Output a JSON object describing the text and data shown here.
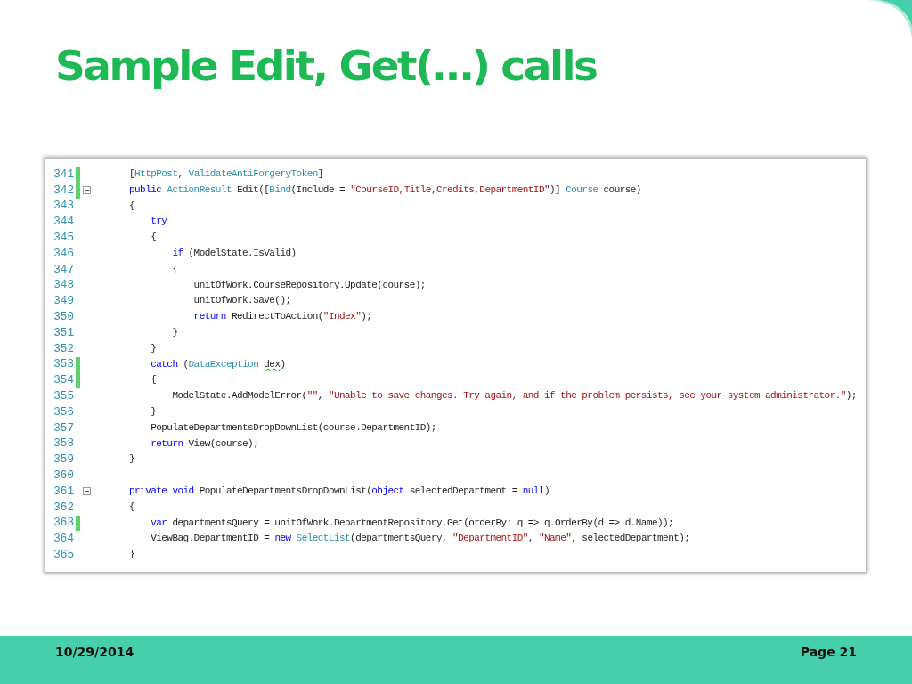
{
  "title": "Sample Edit, Get(…) calls",
  "code_lines": [
    {
      "number": "341",
      "changed": true,
      "foldable": false,
      "tokens": [
        {
          "kind": "plain",
          "text": "["
        },
        {
          "kind": "type",
          "text": "HttpPost"
        },
        {
          "kind": "plain",
          "text": ", "
        },
        {
          "kind": "type",
          "text": "ValidateAntiForgeryToken"
        },
        {
          "kind": "plain",
          "text": "]"
        }
      ]
    },
    {
      "number": "342",
      "changed": true,
      "foldable": true,
      "tokens": [
        {
          "kind": "keyword",
          "text": "public "
        },
        {
          "kind": "type",
          "text": "ActionResult"
        },
        {
          "kind": "plain",
          "text": " Edit(["
        },
        {
          "kind": "type",
          "text": "Bind"
        },
        {
          "kind": "plain",
          "text": "(Include = "
        },
        {
          "kind": "string",
          "text": "\"CourseID,Title,Credits,DepartmentID\""
        },
        {
          "kind": "plain",
          "text": ")] "
        },
        {
          "kind": "type",
          "text": "Course"
        },
        {
          "kind": "plain",
          "text": " course)"
        }
      ]
    },
    {
      "number": "343",
      "changed": false,
      "foldable": false,
      "tokens": [
        {
          "kind": "plain",
          "text": "{"
        }
      ],
      "children": [
        {
          "number": "344",
          "changed": false,
          "foldable": false,
          "tokens": [
            {
              "kind": "keyword",
              "text": "try"
            }
          ]
        },
        {
          "number": "345",
          "changed": false,
          "foldable": false,
          "tokens": [
            {
              "kind": "plain",
              "text": "{"
            }
          ],
          "children": [
            {
              "number": "346",
              "changed": false,
              "foldable": false,
              "tokens": [
                {
                  "kind": "keyword",
                  "text": "if"
                },
                {
                  "kind": "plain",
                  "text": " (ModelState.IsValid)"
                }
              ]
            },
            {
              "number": "347",
              "changed": false,
              "foldable": false,
              "tokens": [
                {
                  "kind": "plain",
                  "text": "{"
                }
              ],
              "children": [
                {
                  "number": "348",
                  "changed": false,
                  "foldable": false,
                  "tokens": [
                    {
                      "kind": "plain",
                      "text": "unitOfWork.CourseRepository.Update(course);"
                    }
                  ]
                },
                {
                  "number": "349",
                  "changed": false,
                  "foldable": false,
                  "tokens": [
                    {
                      "kind": "plain",
                      "text": "unitOfWork.Save();"
                    }
                  ]
                },
                {
                  "number": "350",
                  "changed": false,
                  "foldable": false,
                  "tokens": [
                    {
                      "kind": "keyword",
                      "text": "return"
                    },
                    {
                      "kind": "plain",
                      "text": " RedirectToAction("
                    },
                    {
                      "kind": "string",
                      "text": "\"Index\""
                    },
                    {
                      "kind": "plain",
                      "text": ");"
                    }
                  ]
                }
              ]
            },
            {
              "number": "351",
              "changed": false,
              "foldable": false,
              "tokens": [
                {
                  "kind": "plain",
                  "text": "}"
                }
              ]
            }
          ]
        },
        {
          "number": "352",
          "changed": false,
          "foldable": false,
          "tokens": [
            {
              "kind": "plain",
              "text": "}"
            }
          ]
        },
        {
          "number": "353",
          "changed": true,
          "foldable": false,
          "tokens": [
            {
              "kind": "keyword",
              "text": "catch"
            },
            {
              "kind": "plain",
              "text": " ("
            },
            {
              "kind": "type",
              "text": "DataException "
            },
            {
              "kind": "warning",
              "text": "dex"
            },
            {
              "kind": "plain",
              "text": ")"
            }
          ]
        },
        {
          "number": "354",
          "changed": true,
          "foldable": false,
          "tokens": [
            {
              "kind": "plain",
              "text": "{"
            }
          ],
          "children": [
            {
              "number": "355",
              "changed": false,
              "foldable": false,
              "tokens": [
                {
                  "kind": "plain",
                  "text": "ModelState.AddModelError("
                },
                {
                  "kind": "string",
                  "text": "\"\""
                },
                {
                  "kind": "plain",
                  "text": ", "
                },
                {
                  "kind": "string",
                  "text": "\"Unable to save changes. Try again, and if the problem persists, see your system administrator.\""
                },
                {
                  "kind": "plain",
                  "text": ");"
                }
              ]
            }
          ]
        },
        {
          "number": "356",
          "changed": false,
          "foldable": false,
          "tokens": [
            {
              "kind": "plain",
              "text": "}"
            }
          ]
        },
        {
          "number": "357",
          "changed": false,
          "foldable": false,
          "tokens": [
            {
              "kind": "plain",
              "text": "PopulateDepartmentsDropDownList(course.DepartmentID);"
            }
          ]
        },
        {
          "number": "358",
          "changed": false,
          "foldable": false,
          "tokens": [
            {
              "kind": "keyword",
              "text": "return"
            },
            {
              "kind": "plain",
              "text": " View(course);"
            }
          ]
        }
      ]
    },
    {
      "number": "359",
      "changed": false,
      "foldable": false,
      "tokens": [
        {
          "kind": "plain",
          "text": "}"
        }
      ]
    },
    {
      "number": "360",
      "changed": false,
      "foldable": false
    },
    {
      "number": "361",
      "changed": false,
      "foldable": true,
      "tokens": [
        {
          "kind": "keyword",
          "text": "private void"
        },
        {
          "kind": "plain",
          "text": " PopulateDepartmentsDropDownList("
        },
        {
          "kind": "keyword",
          "text": "object"
        },
        {
          "kind": "plain",
          "text": " selectedDepartment = "
        },
        {
          "kind": "keyword",
          "text": "null"
        },
        {
          "kind": "plain",
          "text": ")"
        }
      ]
    },
    {
      "number": "362",
      "changed": false,
      "foldable": false,
      "tokens": [
        {
          "kind": "plain",
          "text": "{"
        }
      ],
      "children": [
        {
          "number": "363",
          "changed": true,
          "foldable": false,
          "tokens": [
            {
              "kind": "keyword",
              "text": "var"
            },
            {
              "kind": "plain",
              "text": " departmentsQuery = unitOfWork.DepartmentRepository.Get(orderBy: q => q.OrderBy(d => d.Name));"
            }
          ]
        },
        {
          "number": "364",
          "changed": false,
          "foldable": false,
          "tokens": [
            {
              "kind": "plain",
              "text": "ViewBag.DepartmentID = "
            },
            {
              "kind": "keyword",
              "text": "new "
            },
            {
              "kind": "type",
              "text": "SelectList"
            },
            {
              "kind": "plain",
              "text": "(departmentsQuery, "
            },
            {
              "kind": "string",
              "text": "\"DepartmentID\""
            },
            {
              "kind": "plain",
              "text": ", "
            },
            {
              "kind": "string",
              "text": "\"Name\""
            },
            {
              "kind": "plain",
              "text": ", selectedDepartment);"
            }
          ]
        }
      ]
    },
    {
      "number": "365",
      "changed": false,
      "foldable": false,
      "tokens": [
        {
          "kind": "plain",
          "text": "}"
        }
      ]
    }
  ],
  "footer": {
    "date": "10/29/2014",
    "page": "Page 21"
  }
}
